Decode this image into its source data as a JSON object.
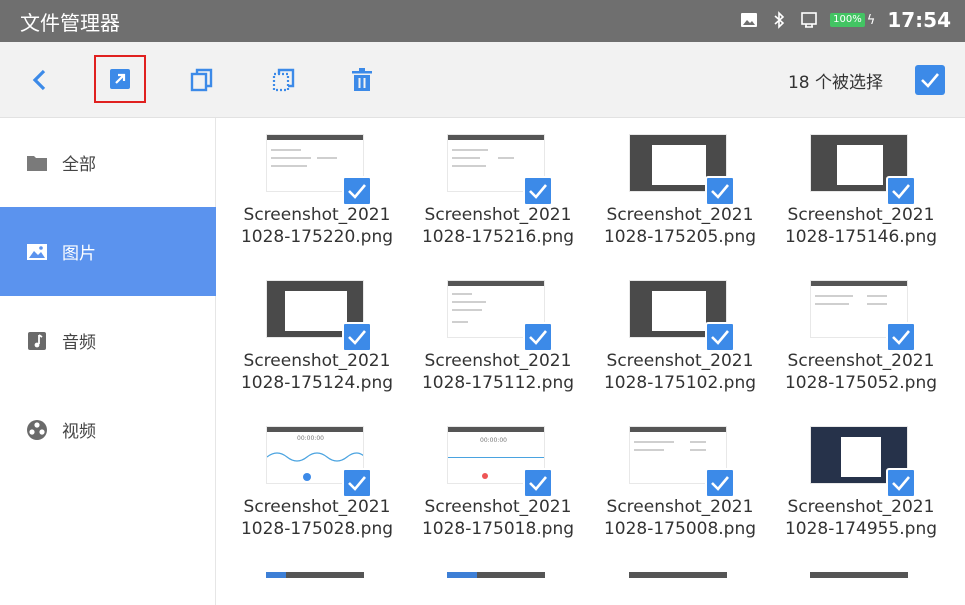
{
  "app_title": "文件管理器",
  "status": {
    "battery_percent": "100%",
    "time": "17:54"
  },
  "toolbar": {
    "selected_count": "18 个被选择"
  },
  "sidebar": {
    "items": [
      {
        "label": "全部",
        "icon": "folder-icon"
      },
      {
        "label": "图片",
        "icon": "image-icon",
        "active": true
      },
      {
        "label": "音频",
        "icon": "music-icon"
      },
      {
        "label": "视频",
        "icon": "video-reel-icon"
      }
    ]
  },
  "files": [
    {
      "line1": "Screenshot_2021",
      "line2": "1028-175220.png",
      "style": "light"
    },
    {
      "line1": "Screenshot_2021",
      "line2": "1028-175216.png",
      "style": "light"
    },
    {
      "line1": "Screenshot_2021",
      "line2": "1028-175205.png",
      "style": "dark"
    },
    {
      "line1": "Screenshot_2021",
      "line2": "1028-175146.png",
      "style": "dark"
    },
    {
      "line1": "Screenshot_2021",
      "line2": "1028-175124.png",
      "style": "dark"
    },
    {
      "line1": "Screenshot_2021",
      "line2": "1028-175112.png",
      "style": "light"
    },
    {
      "line1": "Screenshot_2021",
      "line2": "1028-175102.png",
      "style": "dark"
    },
    {
      "line1": "Screenshot_2021",
      "line2": "1028-175052.png",
      "style": "light"
    },
    {
      "line1": "Screenshot_2021",
      "line2": "1028-175028.png",
      "style": "wave"
    },
    {
      "line1": "Screenshot_2021",
      "line2": "1028-175018.png",
      "style": "wave"
    },
    {
      "line1": "Screenshot_2021",
      "line2": "1028-175008.png",
      "style": "light"
    },
    {
      "line1": "Screenshot_2021",
      "line2": "1028-174955.png",
      "style": "dark"
    }
  ],
  "thumb_texts": {
    "timer_a": "00:00:00",
    "timer_b": "00:00:00"
  },
  "colors": {
    "accent": "#3c8ae8",
    "sidebar_active": "#5b93ee",
    "statusbar": "#6f6f6f",
    "highlight_border": "#e0201f"
  }
}
